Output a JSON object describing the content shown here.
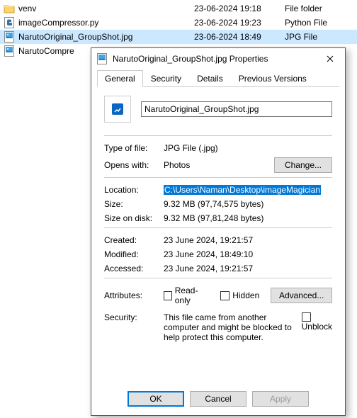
{
  "filelist": {
    "rows": [
      {
        "name": "venv",
        "date": "23-06-2024 19:18",
        "type": "File folder",
        "icon": "folder"
      },
      {
        "name": "imageCompressor.py",
        "date": "23-06-2024 19:23",
        "type": "Python File",
        "icon": "python"
      },
      {
        "name": "NarutoOriginal_GroupShot.jpg",
        "date": "23-06-2024 18:49",
        "type": "JPG File",
        "icon": "jpg",
        "selected": true
      },
      {
        "name": "NarutoCompre",
        "date": "",
        "type": "",
        "icon": "jpg"
      }
    ]
  },
  "dialog": {
    "title": "NarutoOriginal_GroupShot.jpg Properties",
    "tabs": [
      "General",
      "Security",
      "Details",
      "Previous Versions"
    ],
    "filename": "NarutoOriginal_GroupShot.jpg",
    "typeoffile_label": "Type of file:",
    "typeoffile_value": "JPG File (.jpg)",
    "openswith_label": "Opens with:",
    "openswith_value": "Photos",
    "change_btn": "Change...",
    "location_label": "Location:",
    "location_value": "C:\\Users\\Naman\\Desktop\\imageMagician",
    "size_label": "Size:",
    "size_value": "9.32 MB (97,74,575 bytes)",
    "sizeondisk_label": "Size on disk:",
    "sizeondisk_value": "9.32 MB (97,81,248 bytes)",
    "created_label": "Created:",
    "created_value": "23 June 2024, 19:21:57",
    "modified_label": "Modified:",
    "modified_value": "23 June 2024, 18:49:10",
    "accessed_label": "Accessed:",
    "accessed_value": "23 June 2024, 19:21:57",
    "attributes_label": "Attributes:",
    "readonly_label": "Read-only",
    "hidden_label": "Hidden",
    "advanced_btn": "Advanced...",
    "security_label": "Security:",
    "security_value": "This file came from another computer and might be blocked to help protect this computer.",
    "unblock_label": "Unblock",
    "ok_btn": "OK",
    "cancel_btn": "Cancel",
    "apply_btn": "Apply"
  }
}
